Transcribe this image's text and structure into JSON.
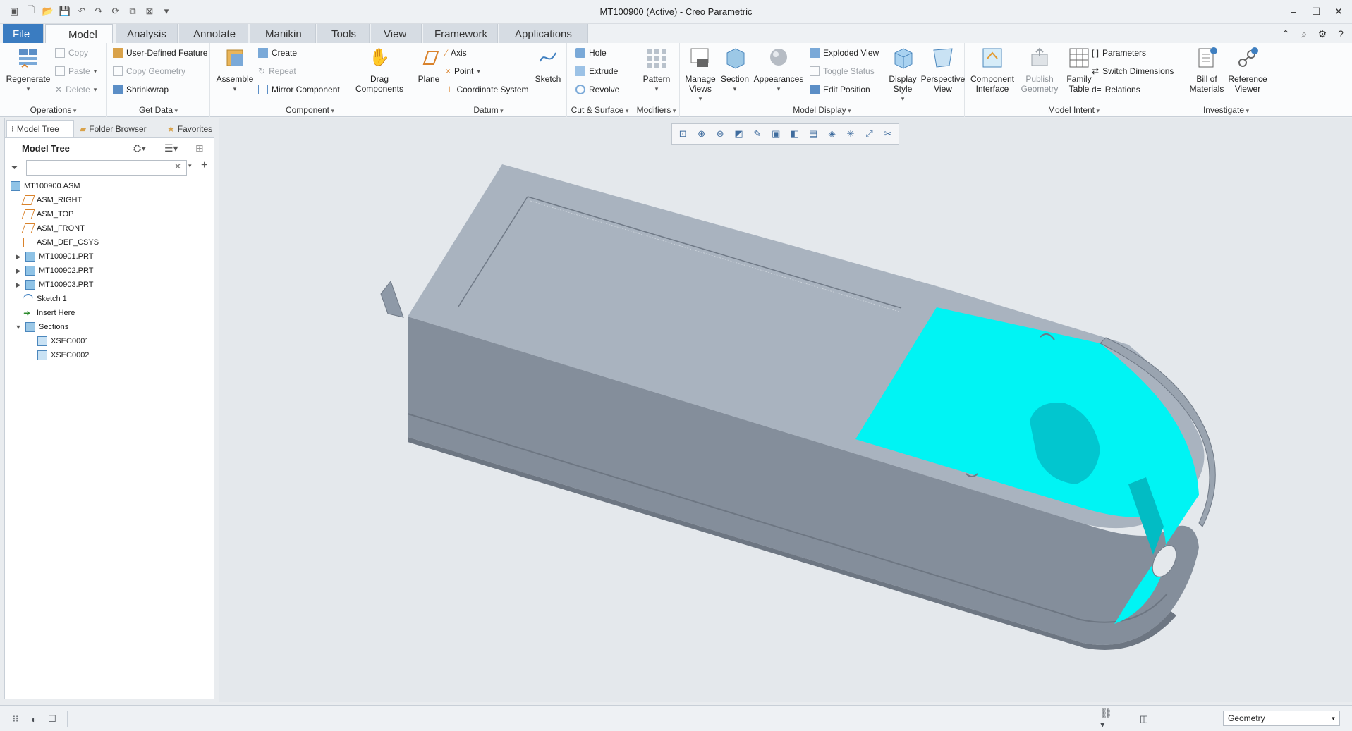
{
  "window": {
    "title": "MT100900 (Active) - Creo Parametric"
  },
  "tabs": [
    "File",
    "Model",
    "Analysis",
    "Annotate",
    "Manikin",
    "Tools",
    "View",
    "Framework",
    "Applications"
  ],
  "ribbon": {
    "operations": {
      "label": "Operations",
      "regenerate": "Regenerate",
      "copy": "Copy",
      "paste": "Paste",
      "delete": "Delete"
    },
    "get_data": {
      "label": "Get Data",
      "udf": "User-Defined Feature",
      "copy_geometry": "Copy Geometry",
      "shrinkwrap": "Shrinkwrap"
    },
    "component": {
      "label": "Component",
      "assemble": "Assemble",
      "create": "Create",
      "repeat": "Repeat",
      "mirror": "Mirror Component",
      "drag": "Drag Components"
    },
    "datum": {
      "label": "Datum",
      "plane": "Plane",
      "axis": "Axis",
      "point": "Point",
      "csys": "Coordinate System",
      "sketch": "Sketch"
    },
    "cut_surface": {
      "label": "Cut & Surface",
      "hole": "Hole",
      "extrude": "Extrude",
      "revolve": "Revolve"
    },
    "modifiers": {
      "label": "Modifiers",
      "pattern": "Pattern"
    },
    "model_display": {
      "label": "Model Display",
      "manage_views": "Manage Views",
      "section": "Section",
      "appearances": "Appearances",
      "exploded_view": "Exploded View",
      "toggle_status": "Toggle Status",
      "edit_position": "Edit Position",
      "display_style": "Display Style",
      "perspective_view": "Perspective View"
    },
    "model_intent": {
      "label": "Model Intent",
      "component_interface": "Component Interface",
      "publish_geometry": "Publish Geometry",
      "family_table": "Family Table",
      "parameters": "Parameters",
      "switch_dimensions": "Switch Dimensions",
      "relations": "Relations"
    },
    "investigate": {
      "label": "Investigate",
      "bom": "Bill of Materials",
      "reference_viewer": "Reference Viewer"
    }
  },
  "panel": {
    "tabs": [
      "Model Tree",
      "Folder Browser",
      "Favorites"
    ],
    "header": "Model Tree",
    "filter_placeholder": "",
    "tree": [
      {
        "label": "MT100900.ASM",
        "icon": "assembly-icon"
      },
      {
        "label": "ASM_RIGHT",
        "icon": "datum-plane-icon"
      },
      {
        "label": "ASM_TOP",
        "icon": "datum-plane-icon"
      },
      {
        "label": "ASM_FRONT",
        "icon": "datum-plane-icon"
      },
      {
        "label": "ASM_DEF_CSYS",
        "icon": "csys-icon"
      },
      {
        "label": "MT100901.PRT",
        "icon": "part-icon"
      },
      {
        "label": "MT100902.PRT",
        "icon": "part-icon"
      },
      {
        "label": "MT100903.PRT",
        "icon": "part-icon"
      },
      {
        "label": "Sketch 1",
        "icon": "sketch-icon"
      },
      {
        "label": "Insert Here",
        "icon": "insert-arrow-icon"
      },
      {
        "label": "Sections",
        "icon": "sections-folder-icon"
      },
      {
        "label": "XSEC0001",
        "icon": "section-icon"
      },
      {
        "label": "XSEC0002",
        "icon": "section-icon"
      }
    ]
  },
  "statusbar": {
    "selection_filter": "Geometry"
  },
  "colors": {
    "file_tab": "#3a7cc1",
    "section_cut": "#00f4f4",
    "model_gray": "#8e99a7",
    "background": "#e4e8ec"
  }
}
